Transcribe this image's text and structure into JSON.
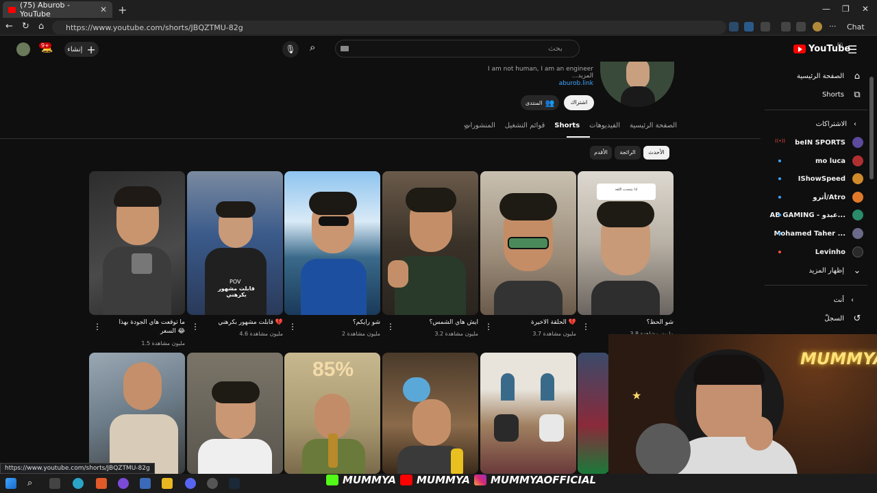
{
  "browser": {
    "tab_title": "(75) Aburob - YouTube",
    "url": "https://www.youtube.com/shorts/JBQZTMU-82g",
    "chat_label": "Chat"
  },
  "header": {
    "search_placeholder": "بحث",
    "create_label": "إنشاء",
    "notif_count": "9+",
    "logo_text": "YouTube",
    "logo_region": "EG"
  },
  "sidebar": {
    "home": "الصفحة الرئيسية",
    "shorts": "Shorts",
    "subs_heading": "الاشتراكات",
    "subscriptions": [
      {
        "name": "beIN SPORTS",
        "color": "#5b4a9e"
      },
      {
        "name": "mo luca",
        "color": "#b03030"
      },
      {
        "name": "IShowSpeed",
        "color": "#d08a2a"
      },
      {
        "name": "أترو/Atro",
        "color": "#e07a2a"
      },
      {
        "name": "AB GAMING - عبدو...",
        "color": "#2a8a6a"
      },
      {
        "name": "Mohamed Taher ...",
        "color": "#6a6a8a"
      },
      {
        "name": "Levinho",
        "color": "#2a2a2a"
      }
    ],
    "show_more": "إظهار المزيد",
    "you_heading": "أنت",
    "history": "السجلّ"
  },
  "channel": {
    "description": "I am not human, I am an engineer ...المزيد",
    "link": "aburob.link",
    "subscribe": "اشتراك",
    "community": "المنتدى"
  },
  "tabs": [
    "المنشورات",
    "قوائم التشغيل",
    "Shorts",
    "الفيديوهات",
    "الصفحة الرئيسية"
  ],
  "chips": [
    "الأحدث",
    "الرائجة",
    "الأقدم"
  ],
  "shorts_row1": [
    {
      "title": "ما توقعت هاي الجودة بهذا السعر 😂",
      "views": "1.5 مليون مشاهدة"
    },
    {
      "title": "قابلت مشهور بكرهني 💔",
      "views": "4.6 مليون مشاهدة"
    },
    {
      "title": "شو رايكم؟",
      "views": "2 مليون مشاهدة"
    },
    {
      "title": "ايش هاي الشمس؟",
      "views": "3.2 مليون مشاهدة"
    },
    {
      "title": "الحلقة الاخيرة 💔",
      "views": "3.7 مليون مشاهدة"
    },
    {
      "title": "شو الحظ؟",
      "views": "3.8 مليون مشاهدة"
    }
  ],
  "thumb_text": {
    "pov": "POV",
    "pov_caption": "قابلت مشهور بكرهني",
    "percent": "85%",
    "sticker": "اذا بتتحدث اللغة"
  },
  "status_url": "https://www.youtube.com/shorts/JBQZTMU-82g",
  "overlay": {
    "handle1": "MUMMYA",
    "handle2": "MUMMYA",
    "handle3": "MUMMYAOFFICIAL",
    "neon_sign": "MUMMYA"
  }
}
